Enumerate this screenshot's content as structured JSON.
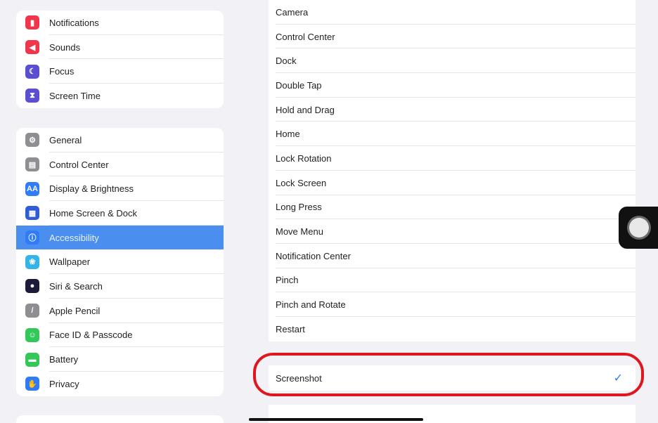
{
  "sidebar": {
    "group1": [
      {
        "label": "Notifications",
        "icon": "notifications-icon",
        "color": "#f0364a",
        "glyph": "▮"
      },
      {
        "label": "Sounds",
        "icon": "sounds-icon",
        "color": "#f0364a",
        "glyph": "◀"
      },
      {
        "label": "Focus",
        "icon": "focus-icon",
        "color": "#5a4fd0",
        "glyph": "☾"
      },
      {
        "label": "Screen Time",
        "icon": "screen-time-icon",
        "color": "#5a4fd0",
        "glyph": "⧗"
      }
    ],
    "group2": [
      {
        "label": "General",
        "icon": "gear-icon",
        "color": "#8e8e93",
        "glyph": "⚙"
      },
      {
        "label": "Control Center",
        "icon": "control-center-icon",
        "color": "#8e8e93",
        "glyph": "▤"
      },
      {
        "label": "Display & Brightness",
        "icon": "display-brightness-icon",
        "color": "#2f7cf6",
        "glyph": "AA"
      },
      {
        "label": "Home Screen & Dock",
        "icon": "home-screen-icon",
        "color": "#2f5cd8",
        "glyph": "▦"
      },
      {
        "label": "Accessibility",
        "icon": "accessibility-icon",
        "color": "#2f7cf6",
        "glyph": "ⓘ",
        "selected": true
      },
      {
        "label": "Wallpaper",
        "icon": "wallpaper-icon",
        "color": "#33b5e8",
        "glyph": "❀"
      },
      {
        "label": "Siri & Search",
        "icon": "siri-icon",
        "color": "#1c1c3a",
        "glyph": "●"
      },
      {
        "label": "Apple Pencil",
        "icon": "pencil-icon",
        "color": "#8e8e93",
        "glyph": "/"
      },
      {
        "label": "Face ID & Passcode",
        "icon": "face-id-icon",
        "color": "#34c759",
        "glyph": "☺"
      },
      {
        "label": "Battery",
        "icon": "battery-icon",
        "color": "#34c759",
        "glyph": "▬"
      },
      {
        "label": "Privacy",
        "icon": "privacy-hand-icon",
        "color": "#2f7cf6",
        "glyph": "✋"
      }
    ]
  },
  "panel": {
    "items": [
      "Camera",
      "Control Center",
      "Dock",
      "Double Tap",
      "Hold and Drag",
      "Home",
      "Lock Rotation",
      "Lock Screen",
      "Long Press",
      "Move Menu",
      "Notification Center",
      "Pinch",
      "Pinch and Rotate",
      "Restart"
    ],
    "selected_item": {
      "label": "Screenshot",
      "checked": true
    },
    "check_glyph": "✓",
    "accent": "#3478f6",
    "highlight_color": "#e0161e"
  }
}
